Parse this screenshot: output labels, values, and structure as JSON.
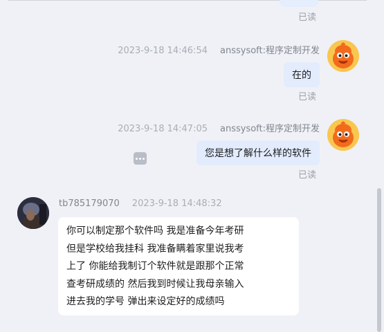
{
  "messages": [
    {
      "direction": "out",
      "read_label": "已读"
    },
    {
      "direction": "out",
      "timestamp": "2023-9-18 14:46:54",
      "sender": "anssysoft:程序定制开发",
      "text": "在的",
      "read_label": "已读",
      "avatar_icon": "mascot-icon"
    },
    {
      "direction": "out",
      "timestamp": "2023-9-18 14:47:05",
      "sender": "anssysoft:程序定制开发",
      "text": "您是想了解什么样的软件",
      "read_label": "已读",
      "avatar_icon": "mascot-icon"
    },
    {
      "direction": "in",
      "timestamp": "2023-9-18 14:48:32",
      "sender": "tb785179070",
      "lines": [
        "你可以制定那个软件吗 我是准备今年考研",
        "但是学校给我挂科 我准备瞒着家里说我考",
        "上了 你能给我制订个软件就是跟那个正常",
        "查考研成绩的 然后我到时候让我母亲输入",
        "进去我的学号 弹出来设定好的成绩吗"
      ],
      "avatar_icon": "user-photo"
    }
  ],
  "icons": {
    "more": "more-options-icon",
    "mascot": "mascot-icon"
  },
  "colors": {
    "background": "#f0f1f6",
    "outgoing_bubble": "#e2ecfd",
    "incoming_bubble": "#ffffff",
    "read_text": "#9aa0aa",
    "mascot_orange": "#f26b1d",
    "mascot_yellow": "#f9c74f"
  }
}
